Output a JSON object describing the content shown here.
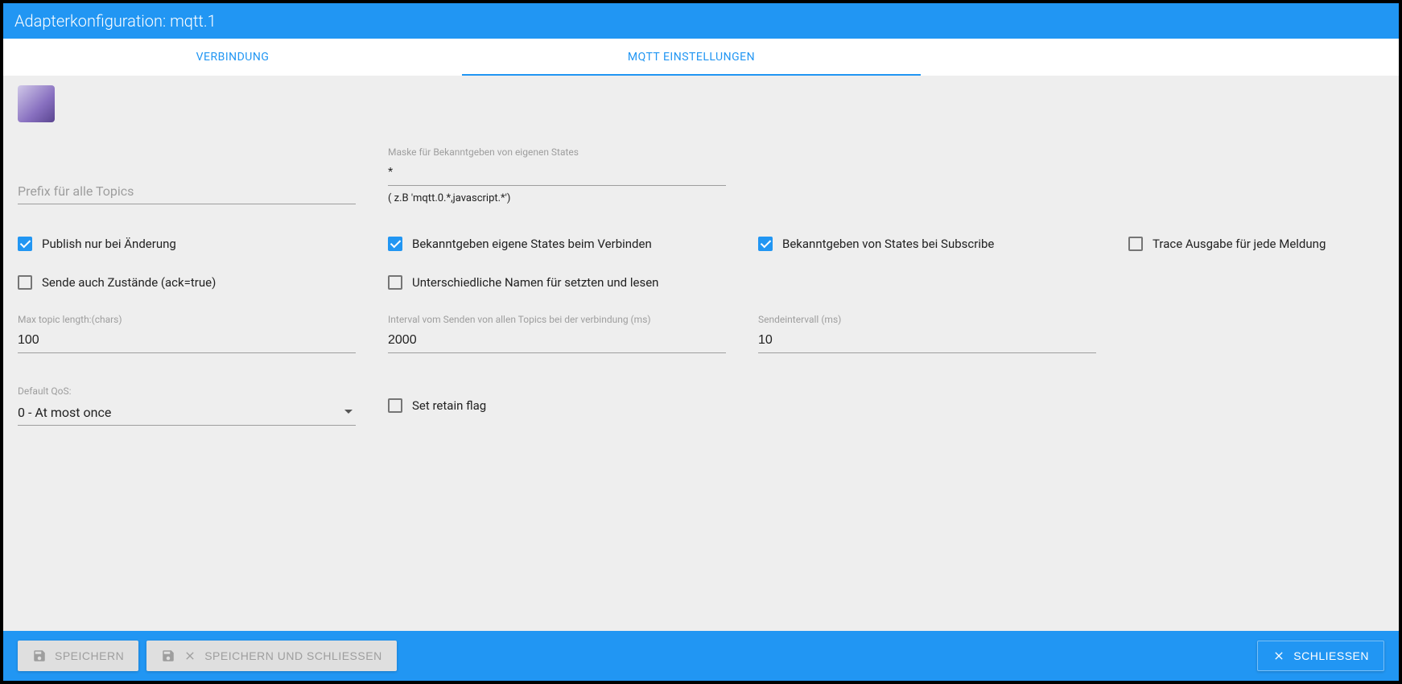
{
  "titlebar": "Adapterkonfiguration: mqtt.1",
  "tabs": {
    "connection": "VERBINDUNG",
    "settings": "MQTT EINSTELLUNGEN"
  },
  "fields": {
    "prefix": {
      "placeholder": "Prefix für alle Topics",
      "value": ""
    },
    "mask": {
      "label": "Maske für Bekanntgeben von eigenen States",
      "value": "*",
      "hint": "( z.B 'mqtt.0.*,javascript.*')"
    },
    "maxTopic": {
      "label": "Max topic length:(chars)",
      "value": "100"
    },
    "intervalAll": {
      "label": "Interval vom Senden von allen Topics bei der verbindung (ms)",
      "value": "2000"
    },
    "sendInterval": {
      "label": "Sendeintervall (ms)",
      "value": "10"
    },
    "qos": {
      "label": "Default QoS:",
      "value": "0 - At most once"
    }
  },
  "checks": {
    "publishOnChange": "Publish nur bei Änderung",
    "publishOnConnect": "Bekanntgeben eigene States beim Verbinden",
    "publishOnSubscribe": "Bekanntgeben von States bei Subscribe",
    "trace": "Trace Ausgabe für jede Meldung",
    "sendAck": "Sende auch Zustände (ack=true)",
    "diffNames": "Unterschiedliche Namen für setzten und lesen",
    "retain": "Set retain flag"
  },
  "buttons": {
    "save": "SPEICHERN",
    "saveClose": "SPEICHERN UND SCHLIESSEN",
    "close": "SCHLIESSEN"
  }
}
